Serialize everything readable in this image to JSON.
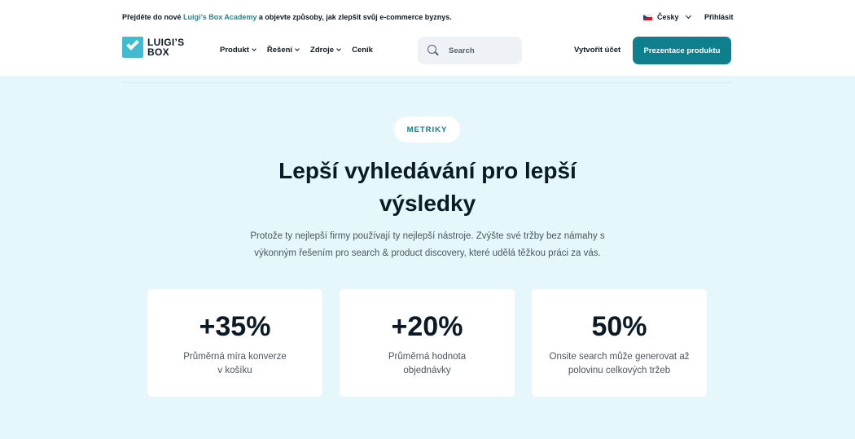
{
  "topbar": {
    "promo_before": "Přejděte do nové ",
    "promo_link": "Luigi’s Box Academy",
    "promo_after": " a objevte způsoby, jak zlepšit svůj e-commerce byznys.",
    "language": "Česky",
    "login": "Přihlásit"
  },
  "nav": {
    "logo_line1": "LUIGI’S",
    "logo_line2": "BOX",
    "menu": [
      "Produkt",
      "Řešení",
      "Zdroje",
      "Ceník"
    ],
    "search_placeholder": "Search",
    "create_account": "Vytvořit účet",
    "cta": "Prezentace produktu"
  },
  "hero": {
    "badge": "METRIKY",
    "title_line1": "Lepší vyhledávání pro lepší",
    "title_line2": "výsledky",
    "subtitle_line1": "Protože ty nejlepší firmy používají ty nejlepší nástroje. Zvýšte své tržby bez námahy s",
    "subtitle_line2": "výkonným řešením pro search & product discovery, které udělá těžkou práci za vás.",
    "cards": [
      {
        "value": "+35%",
        "line1": "Průměrná míra konverze",
        "line2": "v košíku"
      },
      {
        "value": "+20%",
        "line1": "Průměrná hodnota",
        "line2": "objednávky"
      },
      {
        "value": "50%",
        "line1": "Onsite search může generovat až",
        "line2": "polovinu celkových tržeb"
      }
    ]
  },
  "colors": {
    "accent": "#0e7f8c",
    "logo": "#3fbccf",
    "hero_bg": "#e5f7fa"
  }
}
